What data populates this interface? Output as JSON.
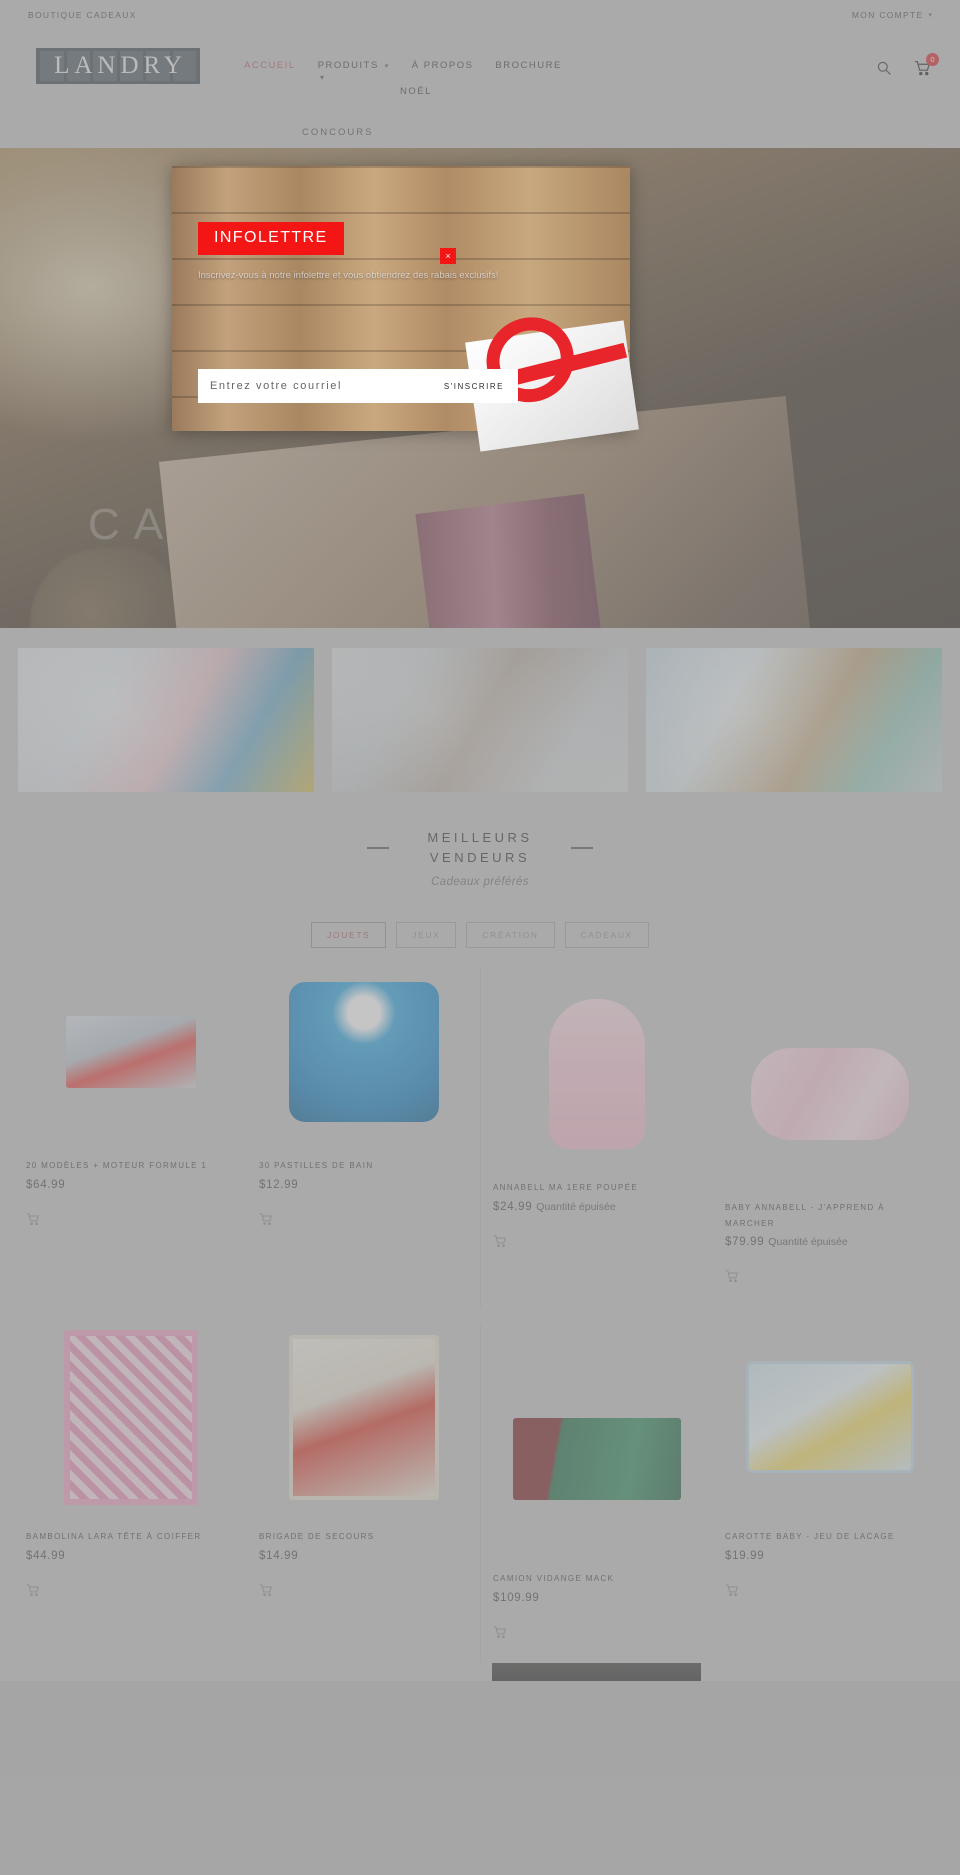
{
  "topbar": {
    "left_link": "BOUTIQUE CADEAUX",
    "account": "MON COMPTE",
    "caret_icon": "chevron-down-icon"
  },
  "header": {
    "logo_text": "LANDRY",
    "nav": [
      {
        "label": "ACCUEIL",
        "active": true,
        "has_caret": false
      },
      {
        "label": "PRODUITS",
        "active": false,
        "has_caret": true
      },
      {
        "label": "À PROPOS",
        "active": false,
        "has_caret": true
      },
      {
        "label": "BROCHURE",
        "active": false,
        "has_caret": false
      }
    ],
    "nav_noel": "NOËL",
    "nav_concours": "CONCOURS",
    "search_icon": "search-icon",
    "cart_icon": "cart-icon",
    "cart_count": "0"
  },
  "hero": {
    "title": "CA"
  },
  "features": [
    {
      "name": "feature-image-kids-toys"
    },
    {
      "name": "feature-image-family"
    },
    {
      "name": "feature-image-gift-hands"
    }
  ],
  "section": {
    "title": "MEILLEURS VENDEURS",
    "subtitle": "Cadeaux préférés",
    "filters": [
      {
        "label": "JOUETS",
        "active": true
      },
      {
        "label": "JEUX",
        "active": false
      },
      {
        "label": "CRÉATION",
        "active": false
      },
      {
        "label": "CADEAUX",
        "active": false
      }
    ]
  },
  "products": [
    {
      "title": "20 MODÈLES + MOTEUR FORMULE 1",
      "price": "$64.99",
      "stock": "",
      "cart_icon": "cart-icon"
    },
    {
      "title": "30 PASTILLES DE BAIN",
      "price": "$12.99",
      "stock": "",
      "cart_icon": "cart-icon"
    },
    {
      "title": "ANNABELL MA 1ERE POUPÉE",
      "price": "$24.99",
      "stock": "Quantité épuisée",
      "cart_icon": "cart-icon"
    },
    {
      "title": "BABY ANNABELL - J'APPREND À MARCHER",
      "price": "$79.99",
      "stock": "Quantité épuisée",
      "cart_icon": "cart-icon"
    },
    {
      "title": "BAMBOLINA LARA TÊTE À COIFFER",
      "price": "$44.99",
      "stock": "",
      "cart_icon": "cart-icon"
    },
    {
      "title": "BRIGADE DE SECOURS",
      "price": "$14.99",
      "stock": "",
      "cart_icon": "cart-icon"
    },
    {
      "title": "CAMION VIDANGE MACK",
      "price": "$109.99",
      "stock": "",
      "cart_icon": "cart-icon"
    },
    {
      "title": "CAROTTE BABY - JEU DE LACAGE",
      "price": "$19.99",
      "stock": "",
      "cart_icon": "cart-icon"
    }
  ],
  "modal": {
    "badge": "INFOLETTRE",
    "subtitle": "Inscrivez-vous à notre infolettre et vous obtiendrez des rabais exclusifs!",
    "email_placeholder": "Entrez votre courriel",
    "email_value": "",
    "submit_label": "S'INSCRIRE",
    "close_label": "×",
    "accent_color": "#f41515"
  }
}
